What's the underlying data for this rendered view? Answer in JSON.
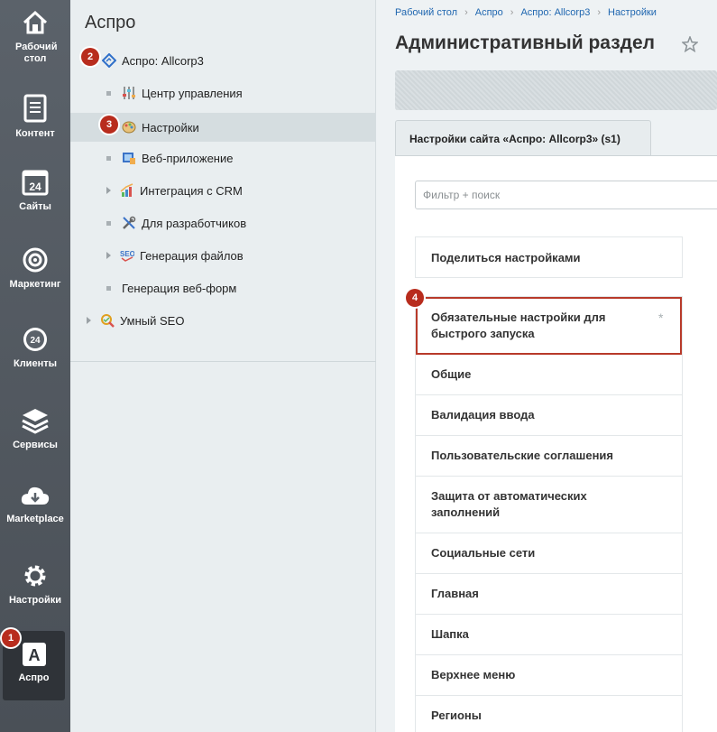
{
  "rail": {
    "items": [
      {
        "label": "Рабочий стол",
        "icon": "home-icon"
      },
      {
        "label": "Контент",
        "icon": "document-icon"
      },
      {
        "label": "Сайты",
        "icon": "calendar-24-icon"
      },
      {
        "label": "Маркетинг",
        "icon": "target-icon"
      },
      {
        "label": "Клиенты",
        "icon": "clients-24-icon"
      },
      {
        "label": "Сервисы",
        "icon": "layers-icon"
      },
      {
        "label": "Marketplace",
        "icon": "cloud-download-icon"
      },
      {
        "label": "Настройки",
        "icon": "gear-icon"
      },
      {
        "label": "Аспро",
        "icon": "aspro-a-icon"
      }
    ],
    "badge": "1"
  },
  "tree": {
    "title": "Аспро",
    "root": {
      "label": "Аспро: Allcorp3",
      "badge": "2"
    },
    "children": [
      {
        "label": "Центр управления"
      },
      {
        "label": "Настройки",
        "badge": "3"
      },
      {
        "label": "Веб-приложение"
      },
      {
        "label": "Интеграция с CRM"
      },
      {
        "label": "Для разработчиков"
      },
      {
        "label": "Генерация файлов"
      },
      {
        "label": "Генерация веб-форм"
      }
    ],
    "sibling": {
      "label": "Умный SEO"
    }
  },
  "main": {
    "breadcrumbs": [
      "Рабочий стол",
      "Аспро",
      "Аспро: Allcorp3",
      "Настройки"
    ],
    "title": "Административный раздел",
    "tab": "Настройки сайта «Аспро: Allcorp3» (s1)",
    "search_placeholder": "Фильтр + поиск",
    "share": "Поделиться настройками",
    "highlight_badge": "4",
    "asterisk": "*",
    "menu": [
      "Обязательные настройки для быстрого запуска",
      "Общие",
      "Валидация ввода",
      "Пользовательские соглашения",
      "Защита от автоматических заполнений",
      "Социальные сети",
      "Главная",
      "Шапка",
      "Верхнее меню",
      "Регионы"
    ]
  }
}
